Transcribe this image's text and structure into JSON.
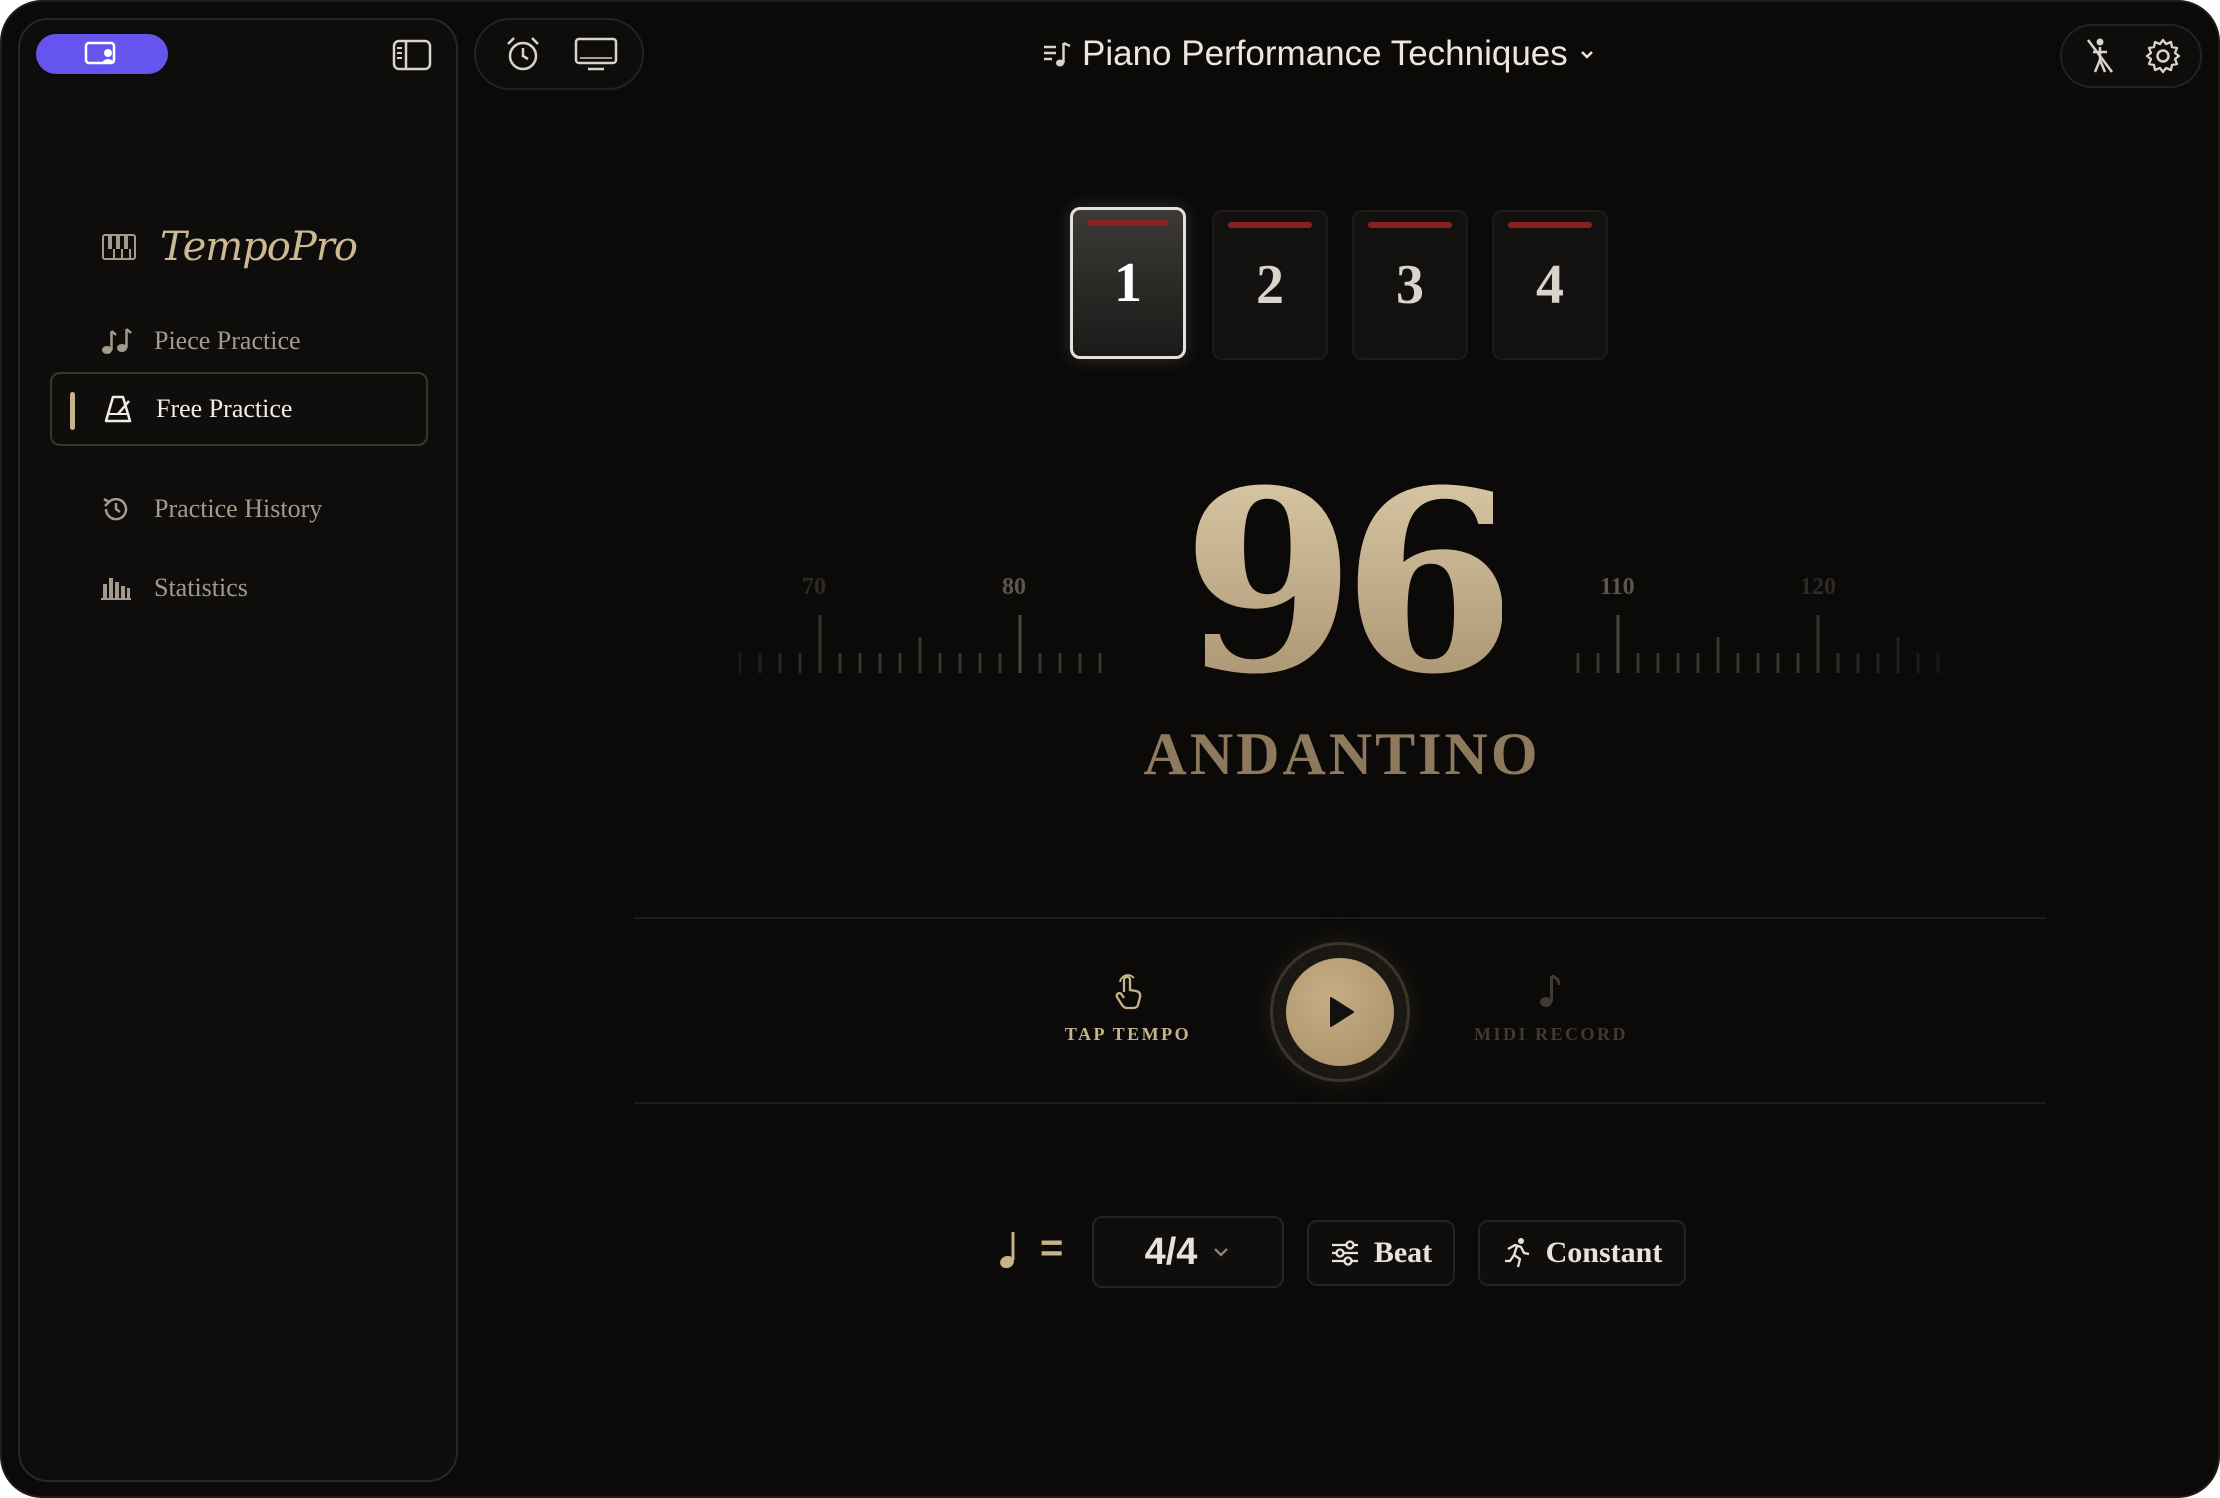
{
  "header": {
    "title": "Piano Performance Techniques"
  },
  "sidebar": {
    "brand": "TempoPro",
    "items": [
      {
        "label": "Piece Practice",
        "icon": "music-notes-icon",
        "active": false
      },
      {
        "label": "Free Practice",
        "icon": "metronome-icon",
        "active": true
      },
      {
        "label": "Practice History",
        "icon": "history-icon",
        "active": false
      },
      {
        "label": "Statistics",
        "icon": "bar-chart-icon",
        "active": false
      }
    ]
  },
  "beats": [
    "1",
    "2",
    "3",
    "4"
  ],
  "current_beat": "1",
  "tempo": {
    "bpm": "96",
    "marking": "ANDANTINO",
    "ruler_labels": [
      "70",
      "80",
      "110",
      "120"
    ]
  },
  "controls": {
    "tap_tempo": "TAP TEMPO",
    "midi_record": "MIDI RECORD"
  },
  "settings": {
    "note_equals": "=",
    "time_signature": "4/4",
    "beat_label": "Beat",
    "mode_label": "Constant"
  },
  "colors": {
    "accent_gold": "#c8b28a",
    "sidebar_pill": "#6555ee",
    "beat_accent_red": "#8a2020",
    "background": "#0b0a09"
  }
}
